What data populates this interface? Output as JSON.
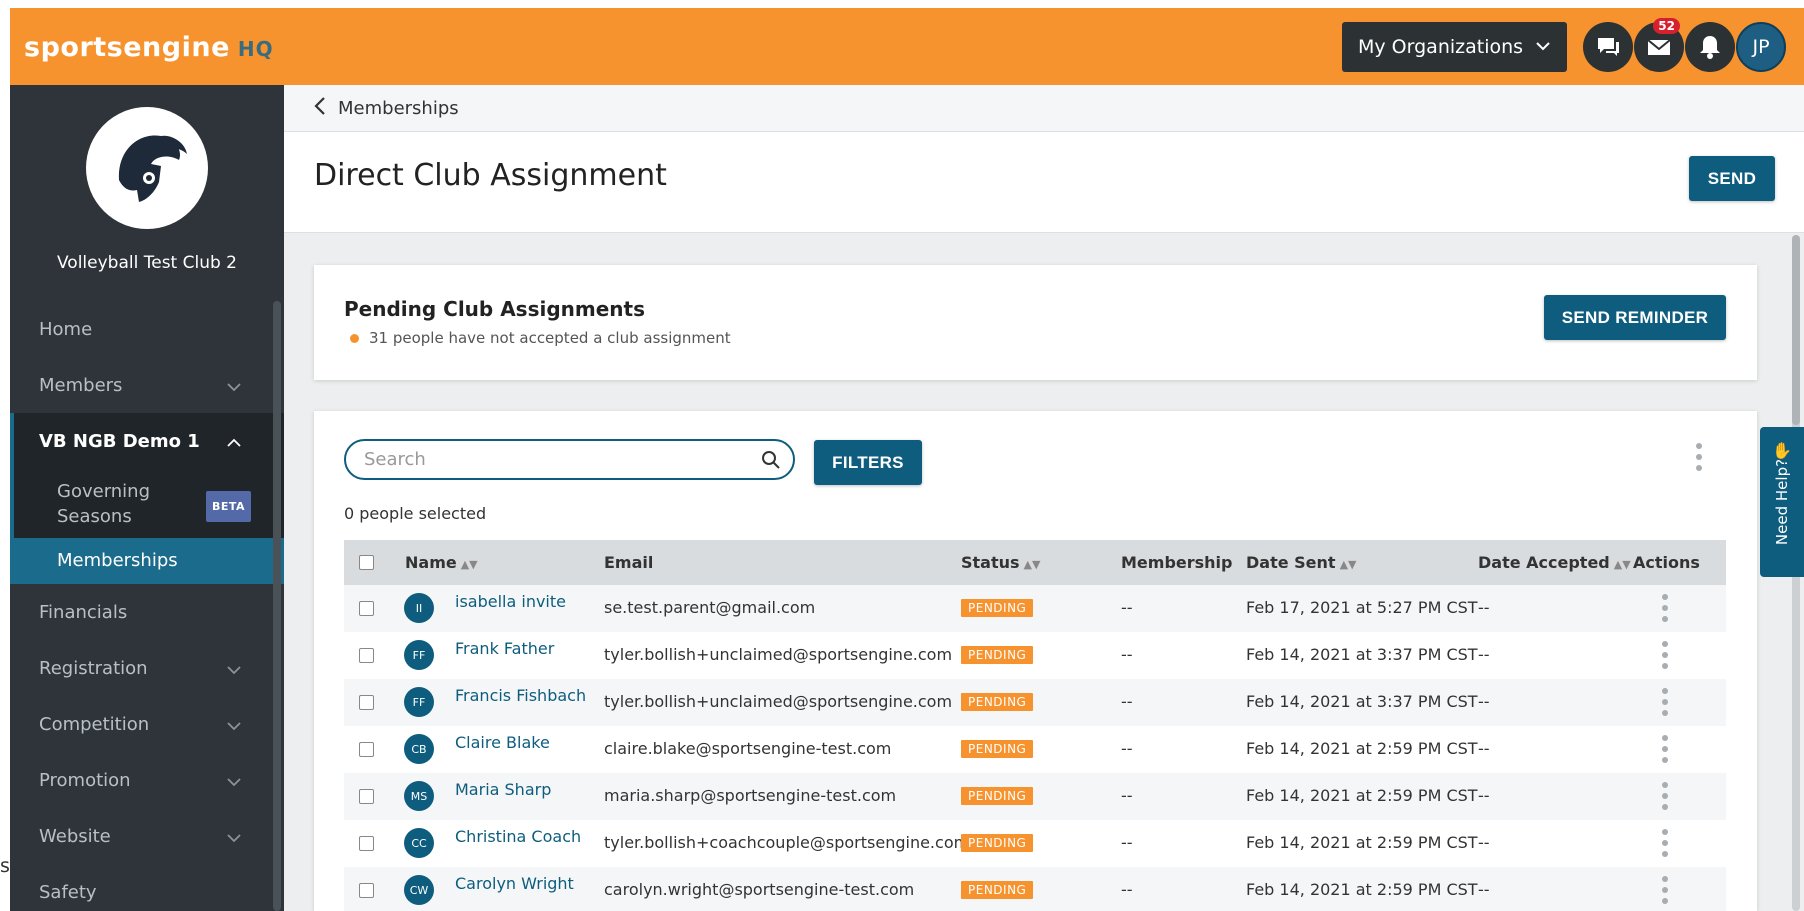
{
  "header": {
    "logo_text": "sportsengine",
    "logo_hq": "HQ",
    "org_selector": "My Organizations",
    "messages_badge": "52",
    "user_initials": "JP"
  },
  "sidebar": {
    "club_name": "Volleyball Test Club 2",
    "items": [
      {
        "label": "Home"
      },
      {
        "label": "Members"
      },
      {
        "label": "VB NGB Demo 1"
      },
      {
        "label": "Governing Seasons",
        "badge": "BETA"
      },
      {
        "label": "Memberships"
      },
      {
        "label": "Financials"
      },
      {
        "label": "Registration"
      },
      {
        "label": "Competition"
      },
      {
        "label": "Promotion"
      },
      {
        "label": "Website"
      },
      {
        "label": "Safety"
      }
    ]
  },
  "stray_char": "s",
  "main": {
    "breadcrumb": "Memberships",
    "page_title": "Direct Club Assignment",
    "send_label": "SEND",
    "pending": {
      "title": "Pending Club Assignments",
      "subtitle": "31 people have not accepted a club assignment",
      "reminder_label": "SEND REMINDER"
    },
    "search_placeholder": "Search",
    "filters_label": "FILTERS",
    "selected_text": "0 people selected",
    "columns": [
      "Name",
      "Email",
      "Status",
      "Membership",
      "Date Sent",
      "Date Accepted",
      "Actions"
    ],
    "rows": [
      {
        "initials": "II",
        "name": "isabella invite",
        "email": "se.test.parent@gmail.com",
        "status": "PENDING",
        "membership": "--",
        "date_sent": "Feb 17, 2021 at 5:27 PM CST",
        "date_accepted": "--"
      },
      {
        "initials": "FF",
        "name": "Frank Father",
        "email": "tyler.bollish+unclaimed@sportsengine.com",
        "status": "PENDING",
        "membership": "--",
        "date_sent": "Feb 14, 2021 at 3:37 PM CST",
        "date_accepted": "--"
      },
      {
        "initials": "FF",
        "name": "Francis Fishbach",
        "email": "tyler.bollish+unclaimed@sportsengine.com",
        "status": "PENDING",
        "membership": "--",
        "date_sent": "Feb 14, 2021 at 3:37 PM CST",
        "date_accepted": "--"
      },
      {
        "initials": "CB",
        "name": "Claire Blake",
        "email": "claire.blake@sportsengine-test.com",
        "status": "PENDING",
        "membership": "--",
        "date_sent": "Feb 14, 2021 at 2:59 PM CST",
        "date_accepted": "--"
      },
      {
        "initials": "MS",
        "name": "Maria Sharp",
        "email": "maria.sharp@sportsengine-test.com",
        "status": "PENDING",
        "membership": "--",
        "date_sent": "Feb 14, 2021 at 2:59 PM CST",
        "date_accepted": "--"
      },
      {
        "initials": "CC",
        "name": "Christina Coach",
        "email": "tyler.bollish+coachcouple@sportsengine.com",
        "status": "PENDING",
        "membership": "--",
        "date_sent": "Feb 14, 2021 at 2:59 PM CST",
        "date_accepted": "--"
      },
      {
        "initials": "CW",
        "name": "Carolyn Wright",
        "email": "carolyn.wright@sportsengine-test.com",
        "status": "PENDING",
        "membership": "--",
        "date_sent": "Feb 14, 2021 at 2:59 PM CST",
        "date_accepted": "--"
      }
    ],
    "need_help": "Need Help?"
  },
  "colors": {
    "brand_orange": "#f7932f",
    "primary_blue": "#0e5d7f",
    "sidebar_dark": "#2e3439"
  },
  "icons": [
    "chat-icon",
    "mail-icon",
    "bell-icon",
    "chevron-down-icon",
    "chevron-left-icon",
    "search-icon",
    "kebab-icon",
    "spartan-helmet-logo"
  ]
}
